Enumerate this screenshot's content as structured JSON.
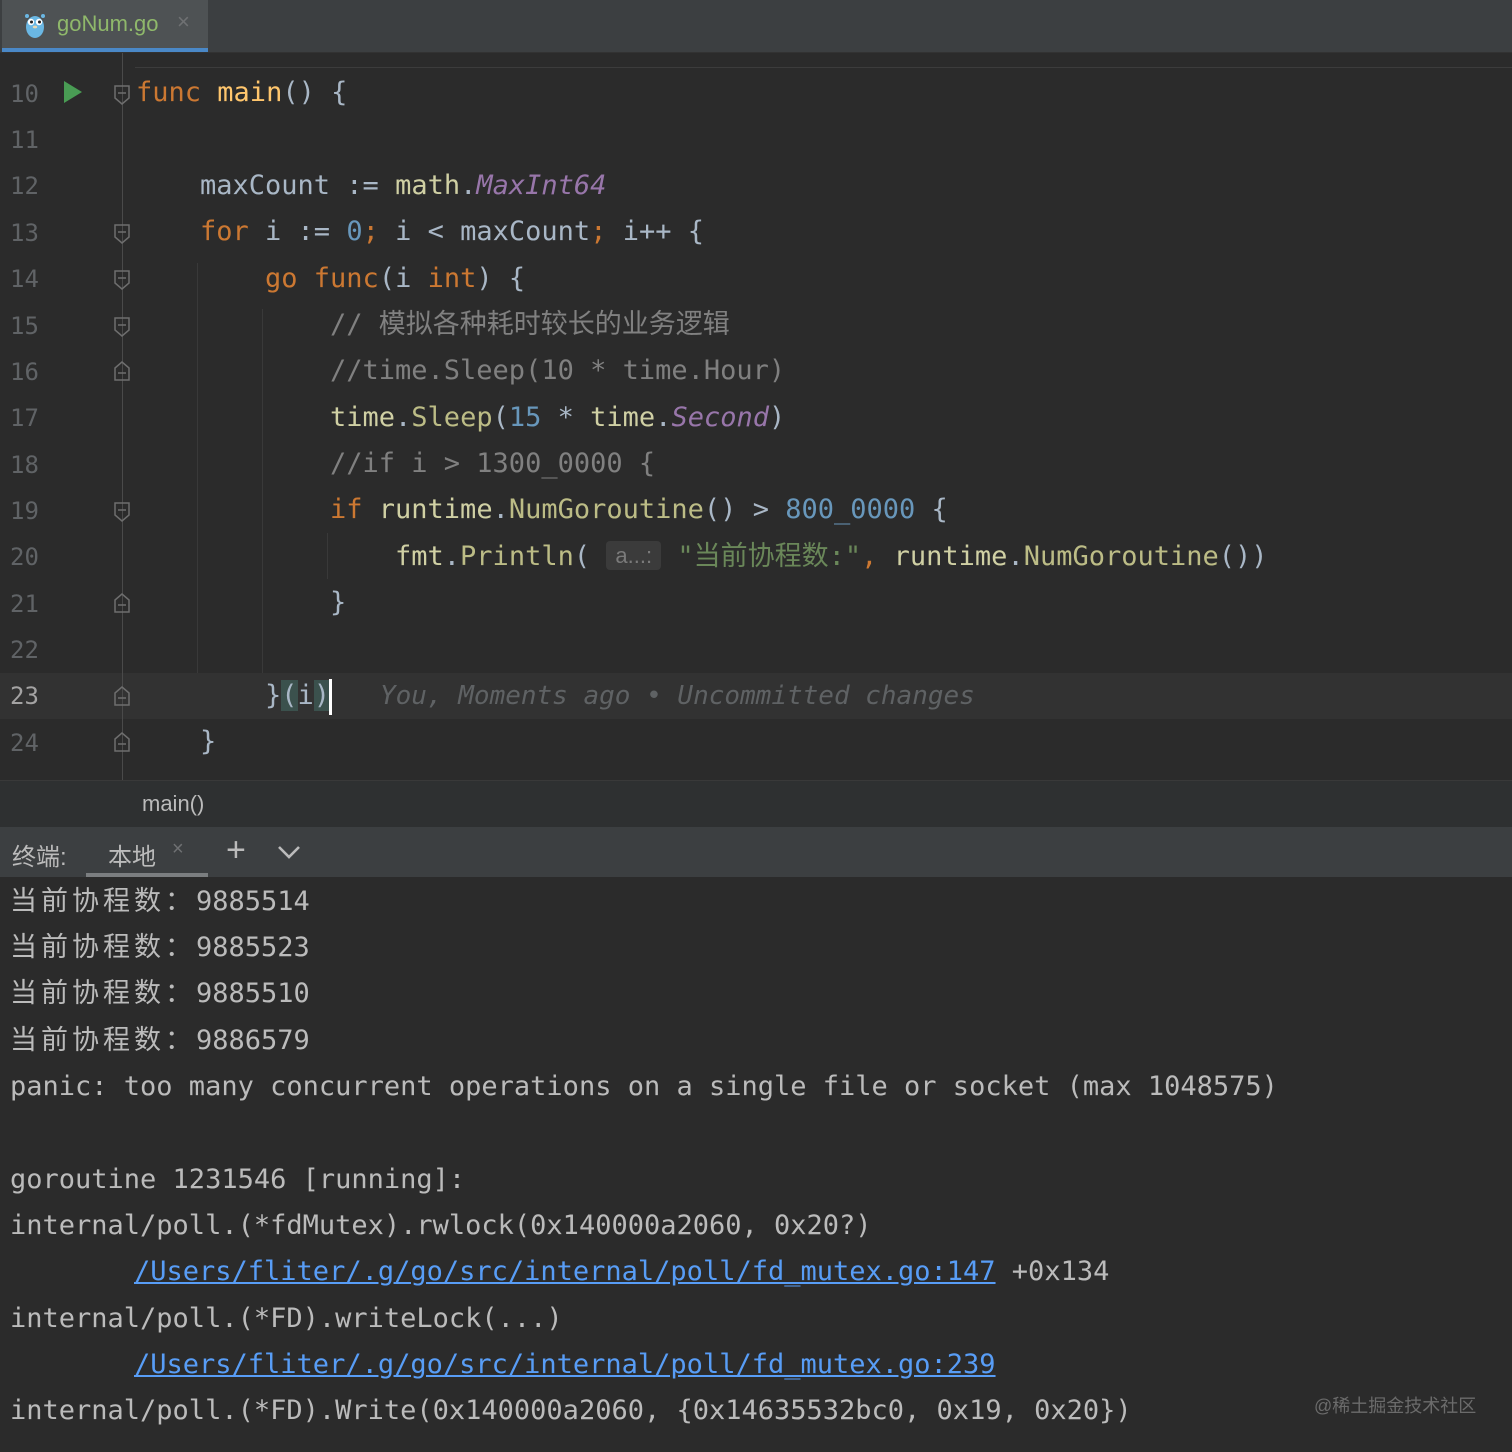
{
  "editor_tab": {
    "label": "goNum.go",
    "icon": "gopher-icon",
    "close": "×"
  },
  "editor": {
    "line_numbers": [
      "10",
      "11",
      "12",
      "13",
      "14",
      "15",
      "16",
      "17",
      "18",
      "19",
      "20",
      "21",
      "22",
      "23",
      "24"
    ],
    "current_line": "23",
    "code": {
      "l10": {
        "kw": "func",
        "name": "main",
        "rest": "() {"
      },
      "l12": {
        "a": "maxCount := ",
        "pkg": "math",
        "dot": ".",
        "const": "MaxInt64"
      },
      "l13": {
        "kw": "for",
        "a": " i := ",
        "num": "0",
        "semi1": ";",
        "b": " i < maxCount",
        "semi2": ";",
        "c": " i++ {"
      },
      "l14": {
        "kw1": "go",
        "sp": " ",
        "kw2": "func",
        "a": "(i ",
        "kw3": "int",
        "b": ") {"
      },
      "l15": {
        "comment": "// 模拟各种耗时较长的业务逻辑"
      },
      "l16": {
        "comment": "//time.Sleep(10 * time.Hour)"
      },
      "l17": {
        "pkg": "time",
        "dot": ".",
        "fn": "Sleep",
        "a": "(",
        "num": "15",
        "b": " * ",
        "pkg2": "time",
        "dot2": ".",
        "const": "Second",
        "c": ")"
      },
      "l18": {
        "comment": "//if i > 1300_0000 {"
      },
      "l19": {
        "kw": "if",
        "sp": " ",
        "pkg": "runtime",
        "dot": ".",
        "fn": "NumGoroutine",
        "a": "() > ",
        "num": "800_0000",
        "b": " {"
      },
      "l20": {
        "pkg": "fmt",
        "dot": ".",
        "fn": "Println",
        "a": "(",
        "hint": "a...:",
        "str": "\"当前协程数:\"",
        "comma": ",",
        "sp": " ",
        "pkg2": "runtime",
        "dot2": ".",
        "fn2": "NumGoroutine",
        "b": "())"
      },
      "l21": {
        "a": "}"
      },
      "l23": {
        "a": "}",
        "p1": "(",
        "i": "i",
        "p2": ")"
      },
      "l24": {
        "a": "}"
      }
    },
    "blame": "You, Moments ago • Uncommitted changes"
  },
  "breadcrumb": {
    "label": "main()"
  },
  "terminal": {
    "title": "终端:",
    "tab_label": "本地",
    "tab_close": "×",
    "add": "+",
    "counts": [
      {
        "label": "当前协程数：",
        "value": "9885514"
      },
      {
        "label": "当前协程数：",
        "value": "9885523"
      },
      {
        "label": "当前协程数：",
        "value": "9885510"
      },
      {
        "label": "当前协程数：",
        "value": "9886579"
      }
    ],
    "panic": "panic: too many concurrent operations on a single file or socket (max 1048575)",
    "goroutine": "goroutine 1231546 [running]:",
    "frame1": "internal/poll.(*fdMutex).rwlock(0x140000a2060, 0x20?)",
    "frame1_link": "/Users/fliter/.g/go/src/internal/poll/fd_mutex.go:147",
    "frame1_offset": " +0x134",
    "frame2": "internal/poll.(*FD).writeLock(...)",
    "frame2_link": "/Users/fliter/.g/go/src/internal/poll/fd_mutex.go:239",
    "frame3": "internal/poll.(*FD).Write(0x140000a2060, {0x14635532bc0, 0x19, 0x20})"
  },
  "watermark": "@稀土掘金技术社区",
  "colors": {
    "keyword": "#cc7832",
    "function": "#ffc66d",
    "number": "#6897bb",
    "constant": "#9876aa",
    "comment": "#808080",
    "string": "#6a8759",
    "link": "#589df6",
    "tab_accent": "#4a88c7"
  }
}
